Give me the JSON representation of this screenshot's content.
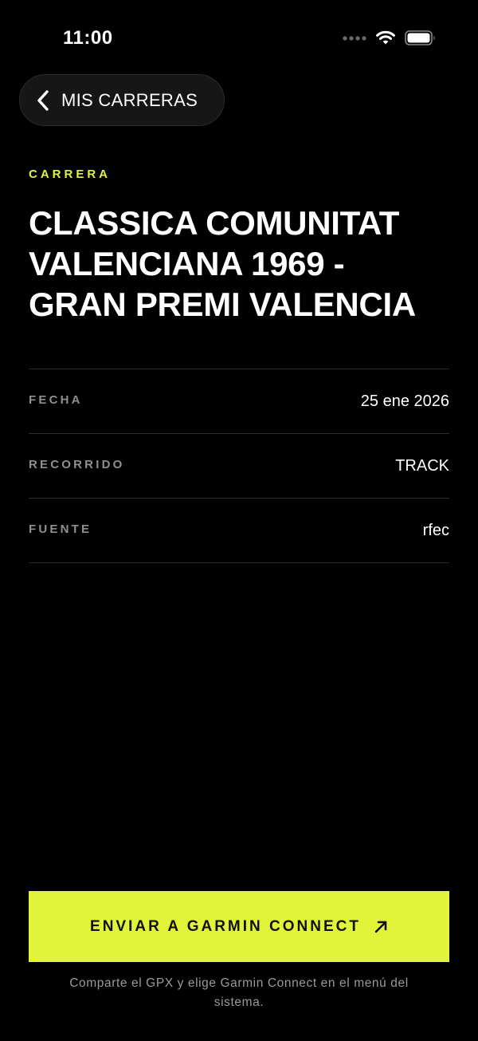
{
  "status_bar": {
    "time": "11:00"
  },
  "nav": {
    "back_label": "MIS CARRERAS"
  },
  "race": {
    "eyebrow": "CARRERA",
    "title": "CLASSICA COMUNITAT VALENCIANA 1969 - GRAN PREMI VALENCIA"
  },
  "details": [
    {
      "key": "FECHA",
      "value": "25 ene 2026"
    },
    {
      "key": "RECORRIDO",
      "value": "TRACK"
    },
    {
      "key": "FUENTE",
      "value": "rfec"
    }
  ],
  "action": {
    "label": "ENVIAR A GARMIN CONNECT",
    "icon": "arrow-up-right-icon",
    "note": "Comparte el GPX y elige Garmin Connect en el menú del sistema."
  },
  "colors": {
    "background": "#000000",
    "accent": "#e1f43a",
    "muted_text": "#8f8f8f",
    "divider": "#2c2c2c"
  },
  "icons": {
    "signal": "cellular-signal-icon",
    "wifi": "wifi-icon",
    "battery": "battery-icon",
    "back": "chevron-left-icon"
  }
}
